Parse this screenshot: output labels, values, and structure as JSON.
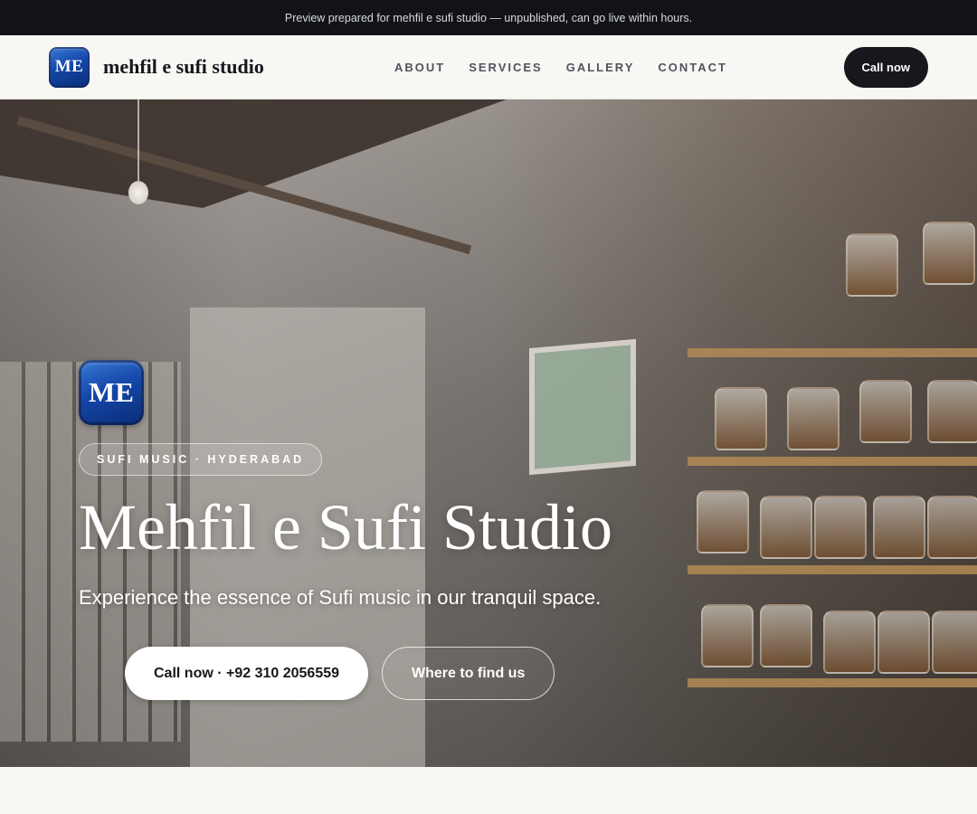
{
  "banner": {
    "text": "Preview prepared for mehfil e sufi studio — unpublished, can go live within hours."
  },
  "header": {
    "logo_text": "ME",
    "brand_name": "mehfil e sufi studio",
    "nav": [
      {
        "label": "ABOUT"
      },
      {
        "label": "SERVICES"
      },
      {
        "label": "GALLERY"
      },
      {
        "label": "CONTACT"
      }
    ],
    "cta_label": "Call now"
  },
  "hero": {
    "logo_text": "ME",
    "tag": "SUFI MUSIC · HYDERABAD",
    "title": "Mehfil e Sufi Studio",
    "subtitle": "Experience the essence of Sufi music in our tranquil space.",
    "primary_cta": "Call now · +92 310 2056559",
    "secondary_cta": "Where to find us"
  },
  "colors": {
    "banner_bg": "#111318",
    "header_bg": "#f8f7f4",
    "dark_button": "#16181d",
    "logo_blue": "#1447a8"
  }
}
